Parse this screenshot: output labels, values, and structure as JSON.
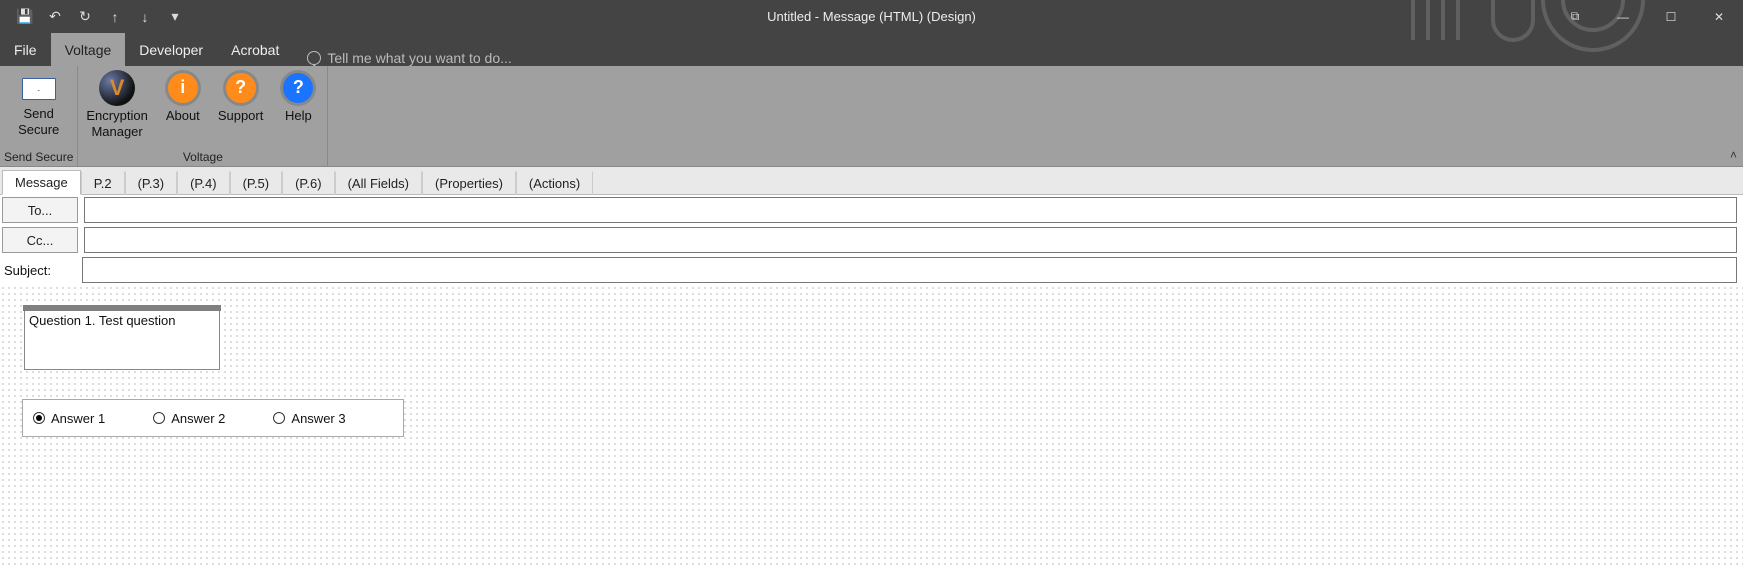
{
  "title": "Untitled - Message (HTML)  (Design)",
  "qat": {
    "save": "💾",
    "undo": "↶",
    "redo": "↻",
    "up": "↑",
    "down": "↓",
    "more": "▾"
  },
  "window_controls": {
    "view_mode": "⧉",
    "minimize": "—",
    "maximize": "☐",
    "close": "✕"
  },
  "menu": {
    "file": "File",
    "voltage": "Voltage",
    "developer": "Developer",
    "acrobat": "Acrobat",
    "tell_me_placeholder": "Tell me what you want to do..."
  },
  "ribbon": {
    "send_secure": {
      "label_line1": "Send",
      "label_line2": "Secure",
      "group_label": "Send Secure"
    },
    "voltage_group_label": "Voltage",
    "encryption_manager": {
      "label_line1": "Encryption",
      "label_line2": "Manager"
    },
    "about": "About",
    "support": "Support",
    "help": "Help",
    "collapse": "˄"
  },
  "page_tabs": {
    "message": "Message",
    "p2": "P.2",
    "p3": "(P.3)",
    "p4": "(P.4)",
    "p5": "(P.5)",
    "p6": "(P.6)",
    "all_fields": "(All Fields)",
    "properties": "(Properties)",
    "actions": "(Actions)"
  },
  "headers": {
    "to_label": "To...",
    "cc_label": "Cc...",
    "subject_label": "Subject:",
    "to_value": "",
    "cc_value": "",
    "subject_value": ""
  },
  "form": {
    "question_text": "Question 1. Test question",
    "answers": {
      "a1": "Answer 1",
      "a2": "Answer 2",
      "a3": "Answer 3"
    }
  }
}
